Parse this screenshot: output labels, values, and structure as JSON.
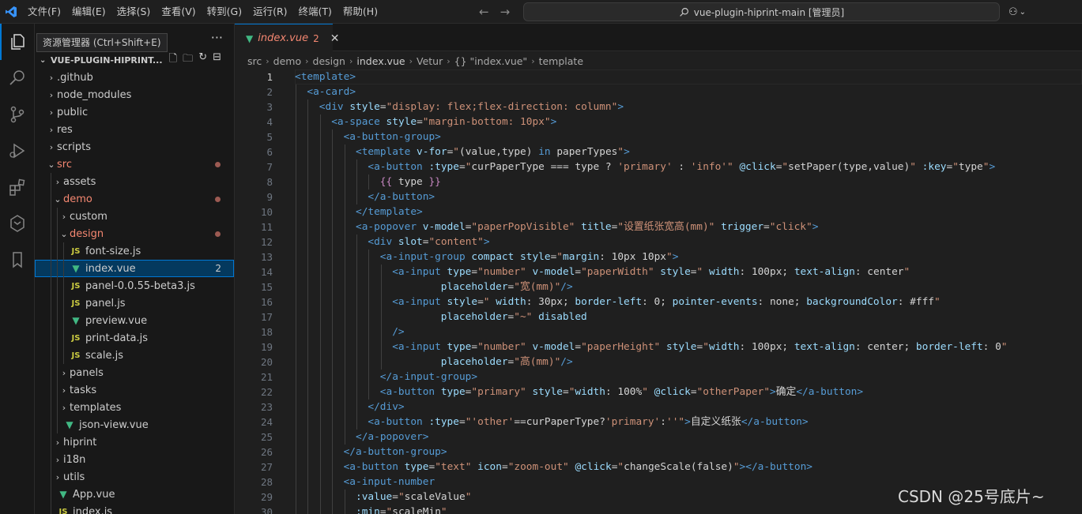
{
  "titlebar": {
    "menu": [
      "文件(F)",
      "编辑(E)",
      "选择(S)",
      "查看(V)",
      "转到(G)",
      "运行(R)",
      "终端(T)",
      "帮助(H)"
    ],
    "search_text": "vue-plugin-hiprint-main [管理员]",
    "accent": "#3794ff"
  },
  "tooltip": "资源管理器 (Ctrl+Shift+E)",
  "explorer": {
    "root": "VUE-PLUGIN-HIPRINT...",
    "items": [
      {
        "label": ".github",
        "depth": 0,
        "kind": "folder",
        "open": false
      },
      {
        "label": "node_modules",
        "depth": 0,
        "kind": "folder",
        "open": false
      },
      {
        "label": "public",
        "depth": 0,
        "kind": "folder",
        "open": false
      },
      {
        "label": "res",
        "depth": 0,
        "kind": "folder",
        "open": false
      },
      {
        "label": "scripts",
        "depth": 0,
        "kind": "folder",
        "open": false
      },
      {
        "label": "src",
        "depth": 0,
        "kind": "folder",
        "open": true,
        "modified": true
      },
      {
        "label": "assets",
        "depth": 1,
        "kind": "folder",
        "open": false
      },
      {
        "label": "demo",
        "depth": 1,
        "kind": "folder",
        "open": true,
        "modified": true
      },
      {
        "label": "custom",
        "depth": 2,
        "kind": "folder",
        "open": false
      },
      {
        "label": "design",
        "depth": 2,
        "kind": "folder",
        "open": true,
        "modified": true
      },
      {
        "label": "font-size.js",
        "depth": 3,
        "kind": "js"
      },
      {
        "label": "index.vue",
        "depth": 3,
        "kind": "vue",
        "selected": true,
        "badge": "2"
      },
      {
        "label": "panel-0.0.55-beta3.js",
        "depth": 3,
        "kind": "js"
      },
      {
        "label": "panel.js",
        "depth": 3,
        "kind": "js"
      },
      {
        "label": "preview.vue",
        "depth": 3,
        "kind": "vue"
      },
      {
        "label": "print-data.js",
        "depth": 3,
        "kind": "js"
      },
      {
        "label": "scale.js",
        "depth": 3,
        "kind": "js"
      },
      {
        "label": "panels",
        "depth": 2,
        "kind": "folder",
        "open": false
      },
      {
        "label": "tasks",
        "depth": 2,
        "kind": "folder",
        "open": false
      },
      {
        "label": "templates",
        "depth": 2,
        "kind": "folder",
        "open": false
      },
      {
        "label": "json-view.vue",
        "depth": 2,
        "kind": "vue"
      },
      {
        "label": "hiprint",
        "depth": 1,
        "kind": "folder",
        "open": false
      },
      {
        "label": "i18n",
        "depth": 1,
        "kind": "folder",
        "open": false
      },
      {
        "label": "utils",
        "depth": 1,
        "kind": "folder",
        "open": false
      },
      {
        "label": "App.vue",
        "depth": 1,
        "kind": "vue"
      },
      {
        "label": "index.js",
        "depth": 1,
        "kind": "js"
      }
    ]
  },
  "tab": {
    "name": "index.vue",
    "problems": "2"
  },
  "breadcrumb": [
    "src",
    "demo",
    "design",
    "index.vue",
    "Vetur",
    "{} \"index.vue\"",
    "template"
  ],
  "colors": {
    "tag": "#569cd6",
    "attr": "#9cdcfe",
    "string": "#ce9178",
    "text": "#d4d4d4",
    "keyword": "#c586c0"
  },
  "code": [
    {
      "n": 1,
      "indent": 0,
      "tokens": [
        [
          "tag",
          "<template>"
        ]
      ]
    },
    {
      "n": 2,
      "indent": 1,
      "tokens": [
        [
          "tag",
          "<a-card>"
        ]
      ]
    },
    {
      "n": 3,
      "indent": 2,
      "tokens": [
        [
          "tag",
          "<div "
        ],
        [
          "attr",
          "style"
        ],
        [
          "text",
          "="
        ],
        [
          "string",
          "\"display: flex;flex-direction: column\""
        ],
        [
          "tag",
          ">"
        ]
      ]
    },
    {
      "n": 4,
      "indent": 3,
      "tokens": [
        [
          "tag",
          "<a-space "
        ],
        [
          "attr",
          "style"
        ],
        [
          "text",
          "="
        ],
        [
          "string",
          "\"margin-bottom: 10px\""
        ],
        [
          "tag",
          ">"
        ]
      ]
    },
    {
      "n": 5,
      "indent": 4,
      "tokens": [
        [
          "tag",
          "<a-button-group>"
        ]
      ]
    },
    {
      "n": 6,
      "indent": 5,
      "tokens": [
        [
          "tag",
          "<template "
        ],
        [
          "attr",
          "v-for"
        ],
        [
          "text",
          "="
        ],
        [
          "string",
          "\""
        ],
        [
          "text",
          "(value,type) "
        ],
        [
          "tag",
          "in"
        ],
        [
          "text",
          " paperTypes"
        ],
        [
          "string",
          "\""
        ],
        [
          "tag",
          ">"
        ]
      ]
    },
    {
      "n": 7,
      "indent": 6,
      "tokens": [
        [
          "tag",
          "<a-button "
        ],
        [
          "attr",
          ":type"
        ],
        [
          "text",
          "="
        ],
        [
          "string",
          "\""
        ],
        [
          "text",
          "curPaperType === type ? "
        ],
        [
          "string",
          "'primary'"
        ],
        [
          "text",
          " : "
        ],
        [
          "string",
          "'info'"
        ],
        [
          "string",
          "\""
        ],
        [
          "text",
          " "
        ],
        [
          "attr",
          "@click"
        ],
        [
          "text",
          "="
        ],
        [
          "string",
          "\""
        ],
        [
          "text",
          "setPaper(type,value)"
        ],
        [
          "string",
          "\""
        ],
        [
          "text",
          " "
        ],
        [
          "attr",
          ":key"
        ],
        [
          "text",
          "="
        ],
        [
          "string",
          "\""
        ],
        [
          "text",
          "type"
        ],
        [
          "string",
          "\""
        ],
        [
          "tag",
          ">"
        ]
      ]
    },
    {
      "n": 8,
      "indent": 7,
      "tokens": [
        [
          "keyword",
          "{{ "
        ],
        [
          "text",
          "type"
        ],
        [
          "keyword",
          " }}"
        ]
      ]
    },
    {
      "n": 9,
      "indent": 6,
      "tokens": [
        [
          "tag",
          "</a-button>"
        ]
      ]
    },
    {
      "n": 10,
      "indent": 5,
      "tokens": [
        [
          "tag",
          "</template>"
        ]
      ]
    },
    {
      "n": 11,
      "indent": 5,
      "tokens": [
        [
          "tag",
          "<a-popover "
        ],
        [
          "attr",
          "v-model"
        ],
        [
          "text",
          "="
        ],
        [
          "string",
          "\"paperPopVisible\""
        ],
        [
          "text",
          " "
        ],
        [
          "attr",
          "title"
        ],
        [
          "text",
          "="
        ],
        [
          "string",
          "\"设置纸张宽高(mm)\""
        ],
        [
          "text",
          " "
        ],
        [
          "attr",
          "trigger"
        ],
        [
          "text",
          "="
        ],
        [
          "string",
          "\"click\""
        ],
        [
          "tag",
          ">"
        ]
      ]
    },
    {
      "n": 12,
      "indent": 6,
      "tokens": [
        [
          "tag",
          "<div "
        ],
        [
          "attr",
          "slot"
        ],
        [
          "text",
          "="
        ],
        [
          "string",
          "\"content\""
        ],
        [
          "tag",
          ">"
        ]
      ]
    },
    {
      "n": 13,
      "indent": 7,
      "tokens": [
        [
          "tag",
          "<a-input-group "
        ],
        [
          "attr",
          "compact"
        ],
        [
          "text",
          " "
        ],
        [
          "attr",
          "style"
        ],
        [
          "text",
          "="
        ],
        [
          "string",
          "\""
        ],
        [
          "attr",
          "margin"
        ],
        [
          "text",
          ": 10px 10px"
        ],
        [
          "string",
          "\""
        ],
        [
          "tag",
          ">"
        ]
      ]
    },
    {
      "n": 14,
      "indent": 8,
      "tokens": [
        [
          "tag",
          "<a-input "
        ],
        [
          "attr",
          "type"
        ],
        [
          "text",
          "="
        ],
        [
          "string",
          "\"number\""
        ],
        [
          "text",
          " "
        ],
        [
          "attr",
          "v-model"
        ],
        [
          "text",
          "="
        ],
        [
          "string",
          "\"paperWidth\""
        ],
        [
          "text",
          " "
        ],
        [
          "attr",
          "style"
        ],
        [
          "text",
          "="
        ],
        [
          "string",
          "\""
        ],
        [
          "text",
          " "
        ],
        [
          "attr",
          "width"
        ],
        [
          "text",
          ": 100px; "
        ],
        [
          "attr",
          "text-align"
        ],
        [
          "text",
          ": center"
        ],
        [
          "string",
          "\""
        ]
      ]
    },
    {
      "n": 15,
      "indent": 12,
      "tokens": [
        [
          "attr",
          "placeholder"
        ],
        [
          "text",
          "="
        ],
        [
          "string",
          "\"宽(mm)\""
        ],
        [
          "tag",
          "/>"
        ]
      ]
    },
    {
      "n": 16,
      "indent": 8,
      "tokens": [
        [
          "tag",
          "<a-input "
        ],
        [
          "attr",
          "style"
        ],
        [
          "text",
          "="
        ],
        [
          "string",
          "\""
        ],
        [
          "text",
          " "
        ],
        [
          "attr",
          "width"
        ],
        [
          "text",
          ": 30px; "
        ],
        [
          "attr",
          "border-left"
        ],
        [
          "text",
          ": 0; "
        ],
        [
          "attr",
          "pointer-events"
        ],
        [
          "text",
          ": none; "
        ],
        [
          "attr",
          "backgroundColor"
        ],
        [
          "text",
          ": #fff"
        ],
        [
          "string",
          "\""
        ]
      ]
    },
    {
      "n": 17,
      "indent": 12,
      "tokens": [
        [
          "attr",
          "placeholder"
        ],
        [
          "text",
          "="
        ],
        [
          "string",
          "\"~\""
        ],
        [
          "text",
          " "
        ],
        [
          "attr",
          "disabled"
        ]
      ]
    },
    {
      "n": 18,
      "indent": 8,
      "tokens": [
        [
          "tag",
          "/>"
        ]
      ]
    },
    {
      "n": 19,
      "indent": 8,
      "tokens": [
        [
          "tag",
          "<a-input "
        ],
        [
          "attr",
          "type"
        ],
        [
          "text",
          "="
        ],
        [
          "string",
          "\"number\""
        ],
        [
          "text",
          " "
        ],
        [
          "attr",
          "v-model"
        ],
        [
          "text",
          "="
        ],
        [
          "string",
          "\"paperHeight\""
        ],
        [
          "text",
          " "
        ],
        [
          "attr",
          "style"
        ],
        [
          "text",
          "="
        ],
        [
          "string",
          "\""
        ],
        [
          "attr",
          "width"
        ],
        [
          "text",
          ": 100px; "
        ],
        [
          "attr",
          "text-align"
        ],
        [
          "text",
          ": center; "
        ],
        [
          "attr",
          "border-left"
        ],
        [
          "text",
          ": 0"
        ],
        [
          "string",
          "\""
        ]
      ]
    },
    {
      "n": 20,
      "indent": 12,
      "tokens": [
        [
          "attr",
          "placeholder"
        ],
        [
          "text",
          "="
        ],
        [
          "string",
          "\"高(mm)\""
        ],
        [
          "tag",
          "/>"
        ]
      ]
    },
    {
      "n": 21,
      "indent": 7,
      "tokens": [
        [
          "tag",
          "</a-input-group>"
        ]
      ]
    },
    {
      "n": 22,
      "indent": 7,
      "tokens": [
        [
          "tag",
          "<a-button "
        ],
        [
          "attr",
          "type"
        ],
        [
          "text",
          "="
        ],
        [
          "string",
          "\"primary\""
        ],
        [
          "text",
          " "
        ],
        [
          "attr",
          "style"
        ],
        [
          "text",
          "="
        ],
        [
          "string",
          "\""
        ],
        [
          "attr",
          "width"
        ],
        [
          "text",
          ": 100%"
        ],
        [
          "string",
          "\""
        ],
        [
          "text",
          " "
        ],
        [
          "attr",
          "@click"
        ],
        [
          "text",
          "="
        ],
        [
          "string",
          "\"otherPaper\""
        ],
        [
          "tag",
          ">"
        ],
        [
          "text",
          "确定"
        ],
        [
          "tag",
          "</a-button>"
        ]
      ]
    },
    {
      "n": 23,
      "indent": 6,
      "tokens": [
        [
          "tag",
          "</div>"
        ]
      ]
    },
    {
      "n": 24,
      "indent": 6,
      "tokens": [
        [
          "tag",
          "<a-button "
        ],
        [
          "attr",
          ":type"
        ],
        [
          "text",
          "="
        ],
        [
          "string",
          "\""
        ],
        [
          "string",
          "'other'"
        ],
        [
          "text",
          "==curPaperType?"
        ],
        [
          "string",
          "'primary'"
        ],
        [
          "text",
          ":"
        ],
        [
          "string",
          "''"
        ],
        [
          "string",
          "\""
        ],
        [
          "tag",
          ">"
        ],
        [
          "text",
          "自定义纸张"
        ],
        [
          "tag",
          "</a-button>"
        ]
      ]
    },
    {
      "n": 25,
      "indent": 5,
      "tokens": [
        [
          "tag",
          "</a-popover>"
        ]
      ]
    },
    {
      "n": 26,
      "indent": 4,
      "tokens": [
        [
          "tag",
          "</a-button-group>"
        ]
      ]
    },
    {
      "n": 27,
      "indent": 4,
      "tokens": [
        [
          "tag",
          "<a-button "
        ],
        [
          "attr",
          "type"
        ],
        [
          "text",
          "="
        ],
        [
          "string",
          "\"text\""
        ],
        [
          "text",
          " "
        ],
        [
          "attr",
          "icon"
        ],
        [
          "text",
          "="
        ],
        [
          "string",
          "\"zoom-out\""
        ],
        [
          "text",
          " "
        ],
        [
          "attr",
          "@click"
        ],
        [
          "text",
          "="
        ],
        [
          "string",
          "\""
        ],
        [
          "text",
          "changeScale(false)"
        ],
        [
          "string",
          "\""
        ],
        [
          "tag",
          "></a-button>"
        ]
      ]
    },
    {
      "n": 28,
      "indent": 4,
      "tokens": [
        [
          "tag",
          "<a-input-number"
        ]
      ]
    },
    {
      "n": 29,
      "indent": 5,
      "tokens": [
        [
          "attr",
          ":value"
        ],
        [
          "text",
          "="
        ],
        [
          "string",
          "\""
        ],
        [
          "text",
          "scaleValue"
        ],
        [
          "string",
          "\""
        ]
      ]
    },
    {
      "n": 30,
      "indent": 5,
      "tokens": [
        [
          "attr",
          ":min"
        ],
        [
          "text",
          "="
        ],
        [
          "string",
          "\""
        ],
        [
          "text",
          "scaleMin"
        ],
        [
          "string",
          "\""
        ]
      ]
    }
  ],
  "watermark": "CSDN @25号底片~"
}
